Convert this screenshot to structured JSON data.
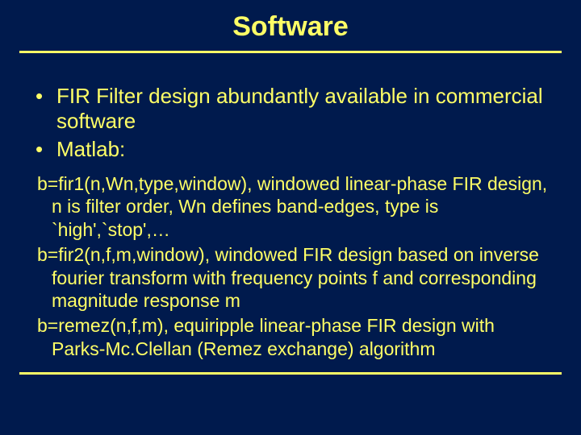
{
  "title": "Software",
  "bullets": {
    "b1": "FIR Filter design abundantly available in commercial software",
    "b2": "Matlab:"
  },
  "sub": {
    "p1": "b=fir1(n,Wn,type,window), windowed linear-phase FIR design, n is filter order, Wn defines band-edges, type is `high',`stop',…",
    "p2": "b=fir2(n,f,m,window),  windowed FIR design based on inverse fourier transform with frequency points f and corresponding magnitude response m",
    "p3": "b=remez(n,f,m), equiripple linear-phase FIR design with Parks-Mc.Clellan (Remez exchange) algorithm"
  }
}
